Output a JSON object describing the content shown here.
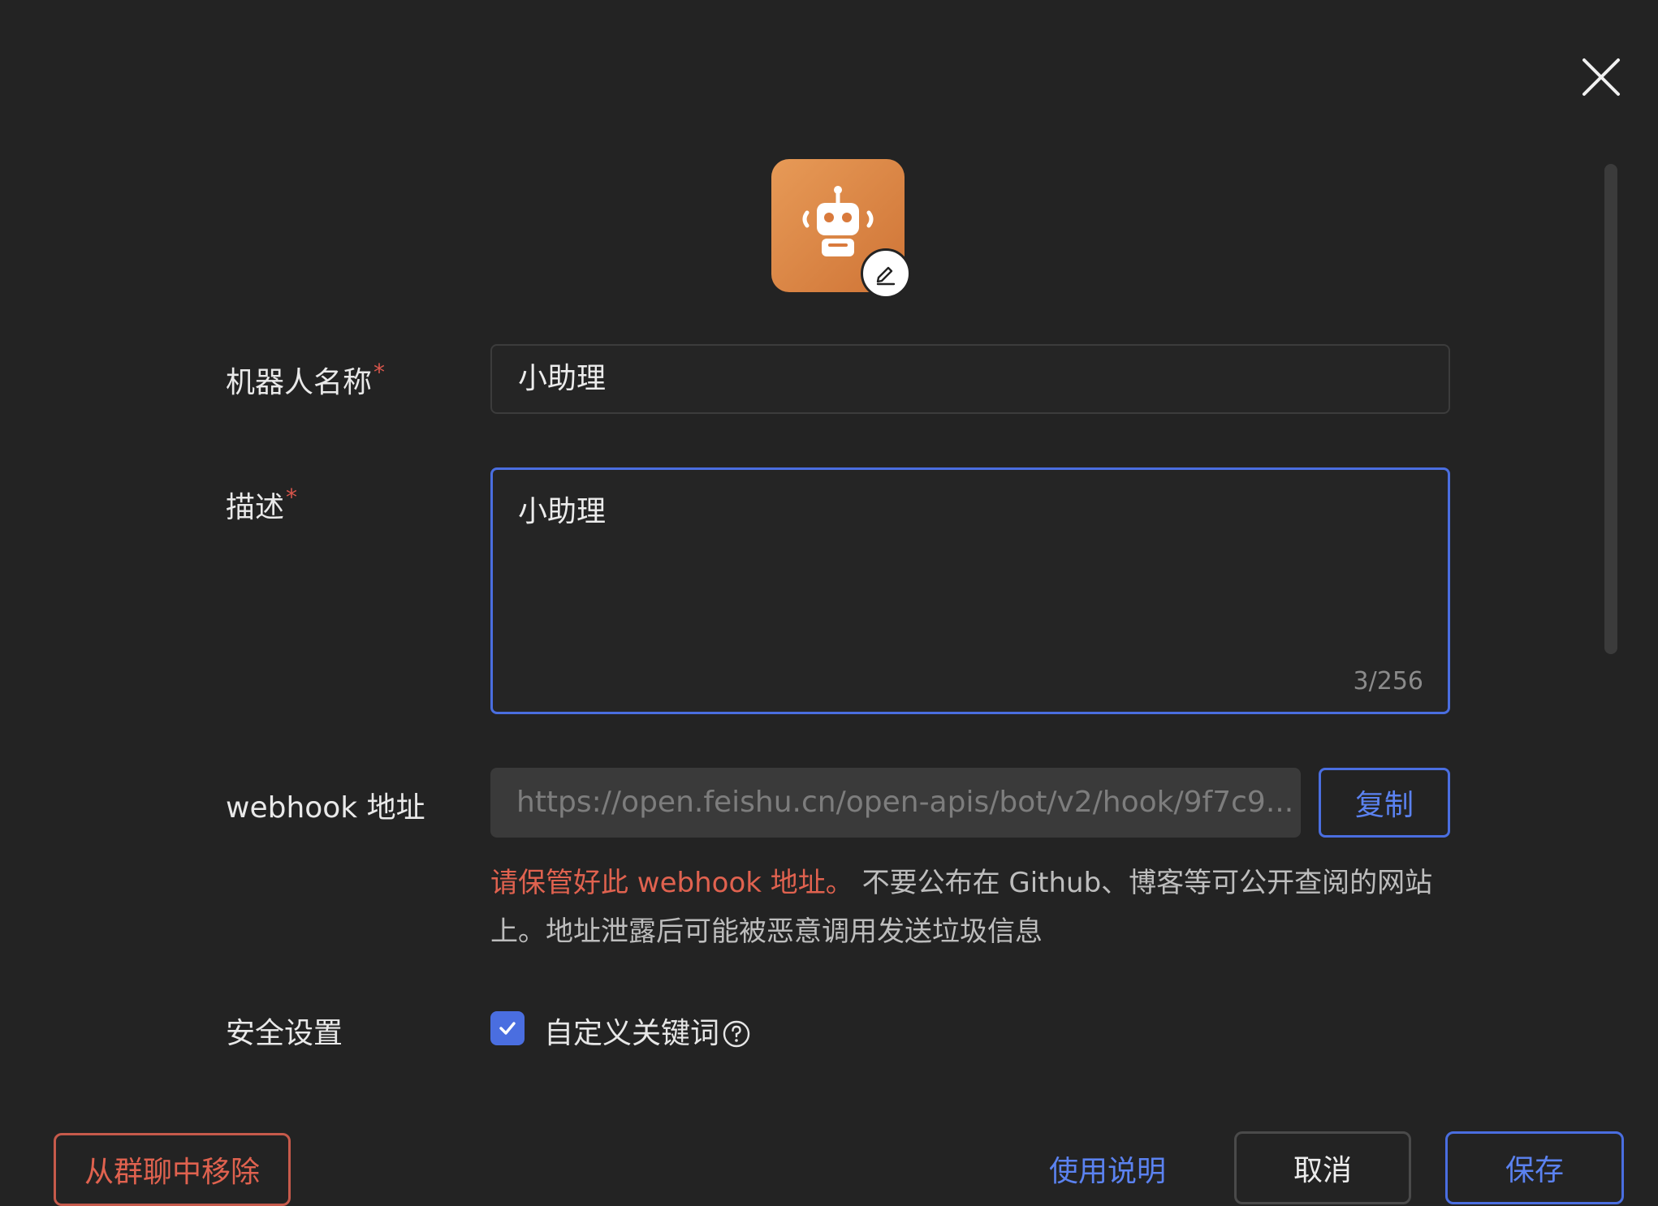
{
  "dialog": {
    "close_icon": "close-icon"
  },
  "avatar": {
    "icon": "robot-icon",
    "edit_icon": "pencil-icon",
    "accent_color": "#dc8244"
  },
  "form": {
    "name_label": "机器人名称",
    "name_required": "*",
    "name_value": "小助理",
    "desc_label": "描述",
    "desc_required": "*",
    "desc_value": "小助理",
    "desc_counter": "3/256",
    "webhook_label": "webhook 地址",
    "webhook_value": "https://open.feishu.cn/open-apis/bot/v2/hook/9f7c9...",
    "copy_label": "复制",
    "warning_highlight": "请保管好此 webhook 地址。",
    "warning_text": " 不要公布在 Github、博客等可公开查阅的网站上。地址泄露后可能被恶意调用发送垃圾信息",
    "security_label": "安全设置",
    "keyword_checkbox_label": "自定义关键词",
    "keyword_checked": true
  },
  "footer": {
    "remove_label": "从群聊中移除",
    "guide_label": "使用说明",
    "cancel_label": "取消",
    "save_label": "保存"
  },
  "colors": {
    "background": "#232323",
    "primary": "#4a6ee0",
    "danger": "#e0624f"
  }
}
